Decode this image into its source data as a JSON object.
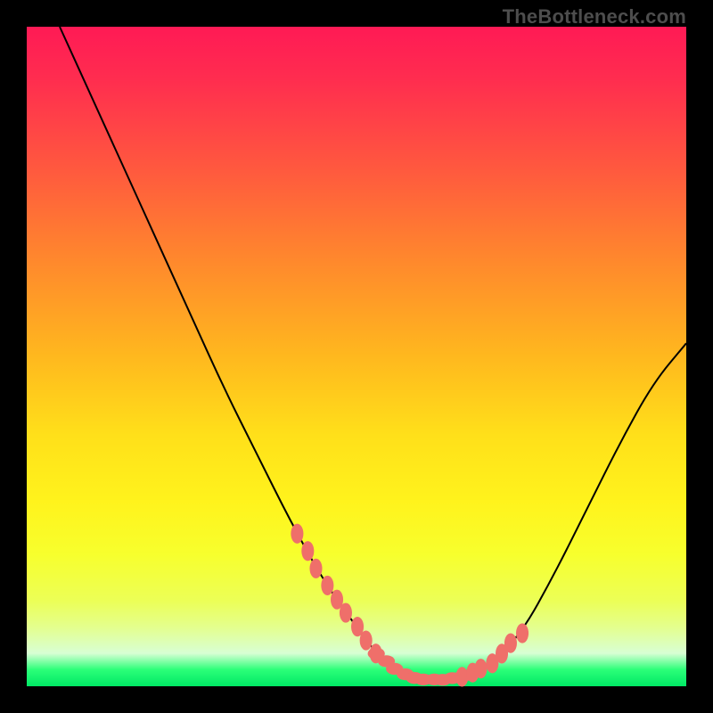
{
  "attribution": "TheBottleneck.com",
  "colors": {
    "frame": "#000000",
    "curve": "#000000",
    "blob": "#ef6f6a",
    "gradient_top": "#ff1a55",
    "gradient_bottom": "#00e865"
  },
  "chart_data": {
    "type": "line",
    "title": "",
    "xlabel": "",
    "ylabel": "",
    "xlim": [
      0,
      100
    ],
    "ylim": [
      0,
      100
    ],
    "grid": false,
    "legend": false,
    "annotations": [],
    "series": [
      {
        "name": "bottleneck-curve",
        "x": [
          5,
          10,
          15,
          20,
          25,
          30,
          35,
          40,
          45,
          50,
          53,
          56,
          58,
          60,
          63,
          66,
          70,
          75,
          80,
          85,
          90,
          95,
          100
        ],
        "y": [
          100,
          89,
          78,
          67,
          56,
          45,
          35,
          25,
          16,
          9,
          5,
          2.5,
          1.5,
          1,
          1,
          1.5,
          3,
          8,
          17,
          27,
          37,
          46,
          52
        ]
      }
    ],
    "highlight_segments": [
      {
        "name": "left-cluster",
        "side": "descending",
        "x_range": [
          41,
          53
        ],
        "y_range": [
          22,
          5
        ]
      },
      {
        "name": "right-cluster",
        "side": "ascending",
        "x_range": [
          66,
          75
        ],
        "y_range": [
          2,
          10
        ]
      },
      {
        "name": "valley-floor",
        "side": "bottom",
        "x_range": [
          53,
          66
        ],
        "y_range": [
          1,
          2
        ]
      }
    ]
  }
}
